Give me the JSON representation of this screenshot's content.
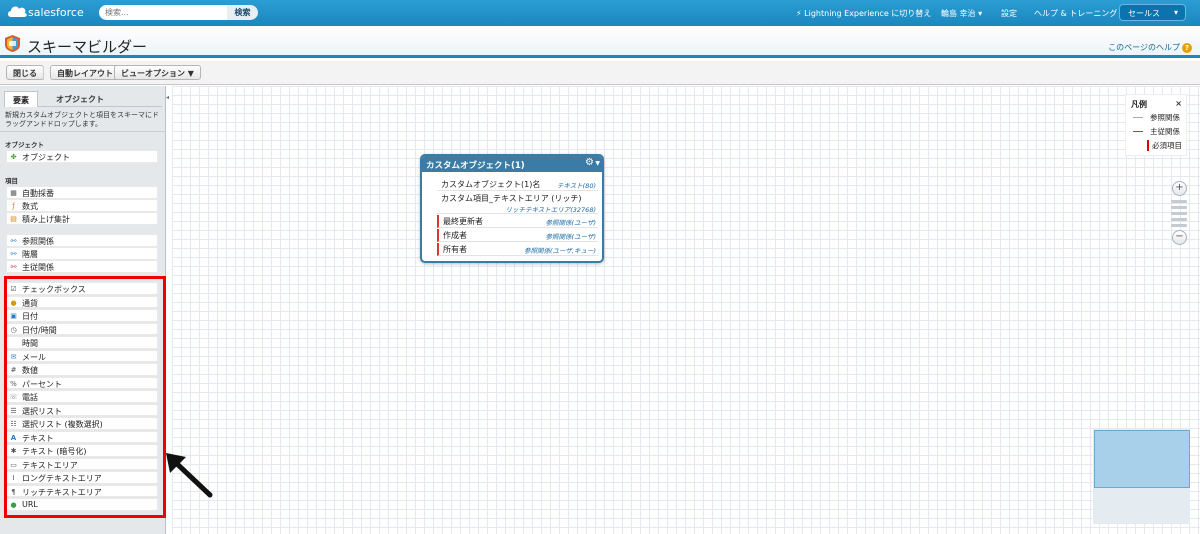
{
  "topbar": {
    "logo_text": "salesforce",
    "search_placeholder": "検索...",
    "search_button": "検索",
    "lightning_link": "Lightning Experience に切り替え",
    "user_menu": "輪島 幸治",
    "settings": "設定",
    "help": "ヘルプ & トレーニング",
    "app_switcher": "セールス"
  },
  "header": {
    "title": "スキーマビルダー",
    "help_link": "このページのヘルプ"
  },
  "toolbar": {
    "close": "閉じる",
    "auto_layout": "自動レイアウト",
    "view_options": "ビューオプション"
  },
  "sidebar": {
    "tabs": [
      "要素",
      "オブジェクト"
    ],
    "description": "新規カスタムオブジェクトと項目をスキーマにドラッグアンドドロップします。",
    "object_section": "オブジェクト",
    "object_items": [
      {
        "label": "オブジェクト",
        "icon": "object-icon"
      }
    ],
    "field_section": "項目",
    "group1": [
      {
        "label": "自動採番",
        "icon": "autonumber-icon"
      },
      {
        "label": "数式",
        "icon": "formula-icon"
      },
      {
        "label": "積み上げ集計",
        "icon": "rollup-icon"
      }
    ],
    "group2": [
      {
        "label": "参照関係",
        "icon": "lookup-icon"
      },
      {
        "label": "階層",
        "icon": "hierarchy-icon"
      },
      {
        "label": "主従関係",
        "icon": "master-detail-icon"
      }
    ],
    "group3": [
      {
        "label": "チェックボックス",
        "icon": "checkbox-icon"
      },
      {
        "label": "通貨",
        "icon": "currency-icon"
      },
      {
        "label": "日付",
        "icon": "date-icon"
      },
      {
        "label": "日付/時間",
        "icon": "datetime-icon"
      },
      {
        "label": "時間",
        "icon": "time-icon"
      },
      {
        "label": "メール",
        "icon": "email-icon"
      },
      {
        "label": "数値",
        "icon": "number-icon"
      },
      {
        "label": "パーセント",
        "icon": "percent-icon"
      },
      {
        "label": "電話",
        "icon": "phone-icon"
      },
      {
        "label": "選択リスト",
        "icon": "picklist-icon"
      },
      {
        "label": "選択リスト (複数選択)",
        "icon": "multi-picklist-icon"
      },
      {
        "label": "テキスト",
        "icon": "text-icon"
      },
      {
        "label": "テキスト (暗号化)",
        "icon": "encrypted-text-icon"
      },
      {
        "label": "テキストエリア",
        "icon": "textarea-icon"
      },
      {
        "label": "ロングテキストエリア",
        "icon": "long-textarea-icon"
      },
      {
        "label": "リッチテキストエリア",
        "icon": "rich-textarea-icon"
      },
      {
        "label": "URL",
        "icon": "url-icon"
      }
    ]
  },
  "object_card": {
    "title": "カスタムオブジェクト(1)",
    "fields": [
      {
        "name": "カスタムオブジェクト(1)名",
        "type": "テキスト(80)",
        "type2": "",
        "required": false
      },
      {
        "name": "カスタム項目_テキストエリア (リッチ)",
        "type": "",
        "type2": "リッチテキストエリア(32768)",
        "required": false
      },
      {
        "name": "最終更新者",
        "type": "参照関係(ユーザ)",
        "type2": "",
        "required": true
      },
      {
        "name": "作成者",
        "type": "参照関係(ユーザ)",
        "type2": "",
        "required": true
      },
      {
        "name": "所有者",
        "type": "参照関係(ユーザ,キュー)",
        "type2": "",
        "required": true
      }
    ]
  },
  "legend": {
    "title": "凡例",
    "close": "×",
    "items": [
      {
        "label": "参照関係",
        "color": "#aaaaaa"
      },
      {
        "label": "主従関係",
        "color": "#c0392b"
      },
      {
        "label": "必須項目",
        "color": "#e00000"
      }
    ]
  },
  "colors": {
    "topbar": "#1b87bd",
    "object_header": "#3a7ca5",
    "highlight_box": "#e00000"
  }
}
